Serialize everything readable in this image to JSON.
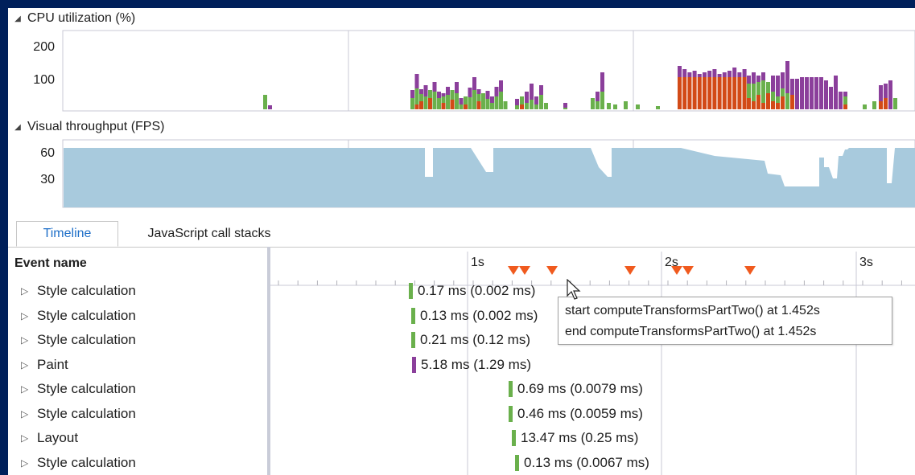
{
  "cpu": {
    "title": "CPU utilization (%)",
    "y_ticks": [
      "200",
      "100"
    ],
    "colors": {
      "green": "#6ab04c",
      "purple": "#8b3f9b",
      "orange": "#d24a17"
    }
  },
  "fps": {
    "title": "Visual throughput (FPS)",
    "y_ticks": [
      "60",
      "30"
    ],
    "fill_color": "#a8cadd"
  },
  "tabs": [
    {
      "label": "Timeline",
      "active": true
    },
    {
      "label": "JavaScript call stacks",
      "active": false
    }
  ],
  "events": {
    "column_header": "Event name",
    "ruler_labels": [
      "1s",
      "2s",
      "3s"
    ],
    "rows": [
      {
        "name": "Style calculation",
        "duration": "0.17 ms (0.002 ms)",
        "color": "#6ab04c"
      },
      {
        "name": "Style calculation",
        "duration": "0.13 ms (0.002 ms)",
        "color": "#6ab04c"
      },
      {
        "name": "Style calculation",
        "duration": "0.21 ms (0.12 ms)",
        "color": "#6ab04c"
      },
      {
        "name": "Paint",
        "duration": "5.18 ms (1.29 ms)",
        "color": "#8b3f9b"
      },
      {
        "name": "Style calculation",
        "duration": "0.69 ms (0.0079 ms)",
        "color": "#6ab04c"
      },
      {
        "name": "Style calculation",
        "duration": "0.46 ms (0.0059 ms)",
        "color": "#6ab04c"
      },
      {
        "name": "Layout",
        "duration": "13.47 ms (0.25 ms)",
        "color": "#6ab04c"
      },
      {
        "name": "Style calculation",
        "duration": "0.13 ms (0.0067 ms)",
        "color": "#6ab04c"
      }
    ]
  },
  "tooltip": {
    "line1": "start computeTransformsPartTwo() at 1.452s",
    "line2": "end computeTransformsPartTwo() at 1.452s"
  },
  "marker_color": "#f05a1e"
}
